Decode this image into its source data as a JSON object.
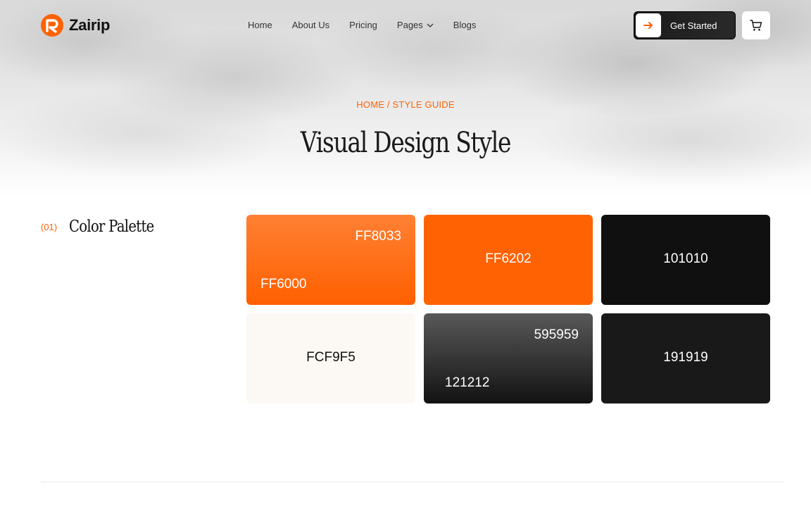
{
  "brand": {
    "name": "Zairip",
    "accent": "#FF6202"
  },
  "nav": {
    "items": [
      {
        "label": "Home"
      },
      {
        "label": "About Us"
      },
      {
        "label": "Pricing"
      },
      {
        "label": "Pages"
      },
      {
        "label": "Blogs"
      }
    ]
  },
  "header": {
    "cta_label": "Get Started",
    "cta_icon": "arrow-right-icon",
    "cart_icon": "shopping-cart-icon"
  },
  "hero": {
    "breadcrumb": "HOME / STYLE GUIDE",
    "title": "Visual Design Style"
  },
  "section": {
    "number": "(01)",
    "title": "Color Palette"
  },
  "palette": {
    "swatch1": {
      "top": "FF8033",
      "bottom": "FF6000"
    },
    "swatch2": {
      "label": "FF6202"
    },
    "swatch3": {
      "label": "101010"
    },
    "swatch4": {
      "label": "FCF9F5"
    },
    "swatch5": {
      "top": "595959",
      "bottom": "121212"
    },
    "swatch6": {
      "label": "191919"
    }
  }
}
